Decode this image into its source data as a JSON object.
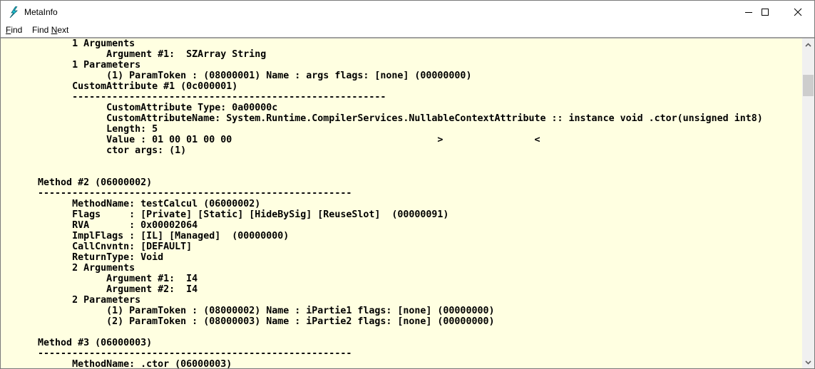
{
  "window": {
    "title": "MetaInfo"
  },
  "menu": [
    {
      "label": "Find",
      "mnemonic_index": 0
    },
    {
      "label": "Find Next",
      "mnemonic_index": 5
    }
  ],
  "lines": [
    "            1 Arguments",
    "                  Argument #1:  SZArray String",
    "            1 Parameters",
    "                  (1) ParamToken : (08000001) Name : args flags: [none] (00000000)",
    "            CustomAttribute #1 (0c000001)",
    "            -------------------------------------------------------",
    "                  CustomAttribute Type: 0a00000c",
    "                  CustomAttributeName: System.Runtime.CompilerServices.NullableContextAttribute :: instance void .ctor(unsigned int8)",
    "                  Length: 5",
    "                  Value : 01 00 01 00 00                                    >                <",
    "                  ctor args: (1)",
    "",
    "",
    "      Method #2 (06000002)",
    "      -------------------------------------------------------",
    "            MethodName: testCalcul (06000002)",
    "            Flags     : [Private] [Static] [HideBySig] [ReuseSlot]  (00000091)",
    "            RVA       : 0x00002064",
    "            ImplFlags : [IL] [Managed]  (00000000)",
    "            CallCnvntn: [DEFAULT]",
    "            ReturnType: Void",
    "            2 Arguments",
    "                  Argument #1:  I4",
    "                  Argument #2:  I4",
    "            2 Parameters",
    "                  (1) ParamToken : (08000002) Name : iPartie1 flags: [none] (00000000)",
    "                  (2) ParamToken : (08000003) Name : iPartie2 flags: [none] (00000000)",
    "",
    "      Method #3 (06000003)",
    "      -------------------------------------------------------",
    "            MethodName: .ctor (06000003)"
  ],
  "colors": {
    "content_bg": "#ffffe1",
    "text": "#000000",
    "scrollbar_bg": "#f0f0f0",
    "thumb": "#cdcdcd"
  },
  "scroll": {
    "position_fraction": 0.1
  }
}
